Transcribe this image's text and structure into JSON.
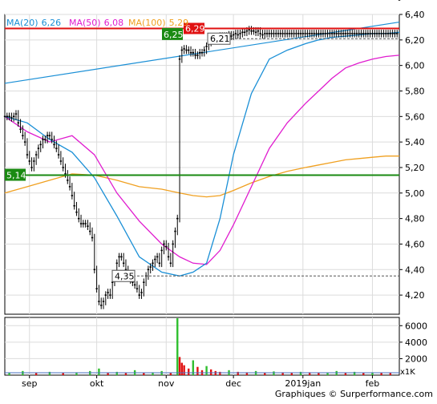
{
  "colors": {
    "ma20": "#1a8fd6",
    "ma50": "#e01ccf",
    "ma100": "#f0a020",
    "price": "#000000",
    "support_line": "#1a8a12",
    "resistance_line": "#e01010",
    "trendline": "#1a8fd6",
    "volume_up": "#2fbf2f",
    "volume_down": "#e01010",
    "volume_flat": "#4a70c0",
    "grid": "#dcdcdc"
  },
  "chart_data": [
    {
      "type": "line",
      "title": "",
      "legend": [
        {
          "series": "ma20",
          "label": "MA(20)",
          "value": "6,26"
        },
        {
          "series": "ma50",
          "label": "MA(50)",
          "value": "6,08"
        },
        {
          "series": "ma100",
          "label": "MA(100)",
          "value": "5,29"
        }
      ],
      "legend_placement": "top-left",
      "grid": true,
      "ylim": [
        4.05,
        6.4
      ],
      "y_ticks": [
        4.2,
        4.4,
        4.6,
        4.8,
        5.0,
        5.2,
        5.4,
        5.6,
        5.8,
        6.0,
        6.2,
        6.4
      ],
      "y_tick_labels": [
        "4,20",
        "4,40",
        "4,60",
        "4,80",
        "5,00",
        "5,20",
        "5,40",
        "5,60",
        "5,80",
        "6,00",
        "6,20",
        "6,40"
      ],
      "x_range_days": [
        0,
        134
      ],
      "x_ticks": [
        {
          "day": 11,
          "label": "sep"
        },
        {
          "day": 41,
          "label": "okt"
        },
        {
          "day": 72,
          "label": "nov"
        },
        {
          "day": 102,
          "label": "dec"
        },
        {
          "day": 133,
          "label": "2019jan"
        },
        {
          "day": 164,
          "label": "feb"
        }
      ],
      "annotations": [
        {
          "value": 5.14,
          "label": "5,14",
          "style": "horizontal-line",
          "color": "support_line"
        },
        {
          "value": 6.29,
          "label": "6,29",
          "style": "horizontal-line",
          "color": "resistance_line"
        },
        {
          "value": 6.25,
          "label": "6,25",
          "style": "price-tag"
        },
        {
          "value": 6.21,
          "label": "6,21",
          "style": "dashed-line"
        },
        {
          "value": 4.35,
          "label": "4,35",
          "style": "dashed-line"
        }
      ],
      "trendline": {
        "from": [
          0,
          5.86
        ],
        "to": [
          176,
          6.34
        ]
      },
      "price_daily": {
        "x": [
          0,
          1,
          2,
          3,
          4,
          5,
          6,
          7,
          8,
          9,
          10,
          11,
          12,
          13,
          14,
          15,
          16,
          17,
          18,
          19,
          20,
          21,
          22,
          23,
          24,
          25,
          26,
          27,
          28,
          29,
          30,
          31,
          32,
          33,
          34,
          35,
          36,
          37,
          38,
          39,
          40,
          41,
          42,
          43,
          44,
          45,
          46,
          47,
          48,
          49,
          50,
          51,
          52,
          53,
          54,
          55,
          56,
          57,
          58,
          59,
          60,
          61,
          62,
          63,
          64,
          65,
          66,
          67,
          68,
          69,
          70,
          71,
          72,
          73,
          74,
          75,
          76,
          77,
          78,
          79,
          80,
          81,
          82,
          83,
          84,
          85,
          86,
          87,
          88,
          89,
          90,
          91,
          92,
          93,
          94,
          95,
          96,
          97,
          98,
          99,
          100,
          101,
          102,
          103,
          104,
          105,
          106,
          107,
          108,
          109,
          110,
          111,
          112,
          113,
          114,
          115,
          116,
          117,
          118,
          119,
          120,
          121,
          122,
          123,
          124,
          125,
          126,
          127,
          128,
          129,
          130,
          131,
          132,
          133,
          134,
          135,
          136,
          137,
          138,
          139,
          140,
          141,
          142,
          143,
          144,
          145,
          146,
          147,
          148,
          149,
          150,
          151,
          152,
          153,
          154,
          155,
          156,
          157,
          158,
          159,
          160,
          161,
          162,
          163,
          164,
          165,
          166,
          167,
          168,
          169,
          170,
          171,
          172,
          173,
          174,
          175,
          176
        ],
        "close": [
          5.6,
          5.6,
          5.6,
          5.59,
          5.6,
          5.62,
          5.55,
          5.5,
          5.45,
          5.4,
          5.3,
          5.25,
          5.2,
          5.25,
          5.3,
          5.35,
          5.38,
          5.42,
          5.42,
          5.45,
          5.45,
          5.42,
          5.38,
          5.35,
          5.3,
          5.25,
          5.2,
          5.15,
          5.1,
          5.05,
          4.98,
          4.9,
          4.85,
          4.8,
          4.76,
          4.76,
          4.76,
          4.74,
          4.7,
          4.65,
          4.4,
          4.25,
          4.15,
          4.12,
          4.15,
          4.2,
          4.22,
          4.2,
          4.3,
          4.35,
          4.45,
          4.5,
          4.5,
          4.45,
          4.4,
          4.35,
          4.32,
          4.3,
          4.28,
          4.25,
          4.2,
          4.22,
          4.3,
          4.35,
          4.4,
          4.42,
          4.45,
          4.48,
          4.5,
          4.45,
          4.55,
          4.6,
          4.58,
          4.5,
          4.45,
          4.6,
          4.7,
          4.8,
          6.05,
          6.12,
          6.13,
          6.12,
          6.12,
          6.1,
          6.1,
          6.08,
          6.08,
          6.1,
          6.1,
          6.12,
          6.15,
          6.18,
          6.2,
          6.21,
          6.22,
          6.22,
          6.23,
          6.23,
          6.22,
          6.23,
          6.24,
          6.23,
          6.24,
          6.25,
          6.24,
          6.25,
          6.26,
          6.26,
          6.27,
          6.28,
          6.27,
          6.27,
          6.26,
          6.27,
          6.25,
          6.24,
          6.25,
          6.25,
          6.25,
          6.25,
          6.25,
          6.25,
          6.25,
          6.25,
          6.25,
          6.25,
          6.25,
          6.25,
          6.25,
          6.25,
          6.25,
          6.25,
          6.25,
          6.25,
          6.25,
          6.25,
          6.25,
          6.25,
          6.25,
          6.25,
          6.25,
          6.25,
          6.25,
          6.25,
          6.25,
          6.25,
          6.25,
          6.25,
          6.25,
          6.25,
          6.25,
          6.25,
          6.25,
          6.25,
          6.25,
          6.25,
          6.25,
          6.25,
          6.25,
          6.25,
          6.25,
          6.25,
          6.25,
          6.25,
          6.25,
          6.25,
          6.25,
          6.25,
          6.25,
          6.25,
          6.25,
          6.25,
          6.25,
          6.25,
          6.25,
          6.25
        ]
      },
      "ma20": {
        "x": [
          0,
          10,
          20,
          30,
          40,
          50,
          60,
          70,
          78,
          84,
          90,
          96,
          102,
          110,
          118,
          126,
          134,
          140,
          146,
          152,
          158,
          164,
          170,
          176
        ],
        "y": [
          5.6,
          5.55,
          5.42,
          5.32,
          5.12,
          4.82,
          4.5,
          4.38,
          4.35,
          4.38,
          4.45,
          4.8,
          5.3,
          5.78,
          6.05,
          6.12,
          6.17,
          6.2,
          6.22,
          6.23,
          6.24,
          6.25,
          6.25,
          6.26
        ]
      },
      "ma50": {
        "x": [
          0,
          10,
          20,
          30,
          40,
          50,
          60,
          70,
          78,
          84,
          90,
          96,
          102,
          110,
          118,
          126,
          134,
          140,
          146,
          152,
          158,
          164,
          170,
          176
        ],
        "y": [
          5.6,
          5.48,
          5.4,
          5.45,
          5.3,
          5.0,
          4.78,
          4.6,
          4.5,
          4.45,
          4.44,
          4.55,
          4.75,
          5.05,
          5.35,
          5.55,
          5.7,
          5.8,
          5.9,
          5.98,
          6.02,
          6.05,
          6.07,
          6.08
        ]
      },
      "ma100": {
        "x": [
          0,
          10,
          20,
          30,
          40,
          50,
          60,
          70,
          78,
          84,
          90,
          96,
          102,
          110,
          118,
          126,
          134,
          140,
          146,
          152,
          158,
          164,
          170,
          176
        ],
        "y": [
          5.0,
          5.05,
          5.1,
          5.15,
          5.14,
          5.1,
          5.05,
          5.03,
          5.0,
          4.98,
          4.97,
          4.98,
          5.02,
          5.08,
          5.13,
          5.17,
          5.2,
          5.22,
          5.24,
          5.26,
          5.27,
          5.28,
          5.29,
          5.29
        ]
      }
    },
    {
      "type": "bar",
      "title": "",
      "unit_label": "x1K",
      "ylim": [
        0,
        7000
      ],
      "y_ticks": [
        2000,
        4000,
        6000
      ],
      "y_tick_labels": [
        "2000",
        "4000",
        "6000"
      ],
      "volume": [
        {
          "day": 2,
          "value": 300
        },
        {
          "day": 8,
          "value": 500
        },
        {
          "day": 14,
          "value": 250
        },
        {
          "day": 20,
          "value": 400
        },
        {
          "day": 26,
          "value": 300
        },
        {
          "day": 32,
          "value": 350
        },
        {
          "day": 38,
          "value": 500
        },
        {
          "day": 42,
          "value": 800
        },
        {
          "day": 46,
          "value": 300
        },
        {
          "day": 50,
          "value": 400
        },
        {
          "day": 54,
          "value": 300
        },
        {
          "day": 58,
          "value": 600
        },
        {
          "day": 62,
          "value": 250
        },
        {
          "day": 66,
          "value": 350
        },
        {
          "day": 70,
          "value": 500
        },
        {
          "day": 74,
          "value": 300
        },
        {
          "day": 77,
          "value": 6900
        },
        {
          "day": 78,
          "value": 2200
        },
        {
          "day": 79,
          "value": 1500
        },
        {
          "day": 80,
          "value": 1200
        },
        {
          "day": 82,
          "value": 800
        },
        {
          "day": 84,
          "value": 1800
        },
        {
          "day": 86,
          "value": 1000
        },
        {
          "day": 88,
          "value": 600
        },
        {
          "day": 90,
          "value": 1100
        },
        {
          "day": 92,
          "value": 700
        },
        {
          "day": 94,
          "value": 500
        },
        {
          "day": 96,
          "value": 400
        },
        {
          "day": 100,
          "value": 600
        },
        {
          "day": 104,
          "value": 400
        },
        {
          "day": 108,
          "value": 350
        },
        {
          "day": 112,
          "value": 500
        },
        {
          "day": 116,
          "value": 300
        },
        {
          "day": 120,
          "value": 450
        },
        {
          "day": 124,
          "value": 350
        },
        {
          "day": 128,
          "value": 300
        },
        {
          "day": 132,
          "value": 400
        },
        {
          "day": 136,
          "value": 350
        },
        {
          "day": 140,
          "value": 300
        },
        {
          "day": 144,
          "value": 300
        },
        {
          "day": 148,
          "value": 500
        },
        {
          "day": 152,
          "value": 300
        },
        {
          "day": 156,
          "value": 400
        },
        {
          "day": 160,
          "value": 300
        },
        {
          "day": 164,
          "value": 350
        },
        {
          "day": 168,
          "value": 300
        },
        {
          "day": 172,
          "value": 250
        }
      ]
    }
  ],
  "footer": {
    "credit": "Graphiques © Surperformance.com"
  }
}
